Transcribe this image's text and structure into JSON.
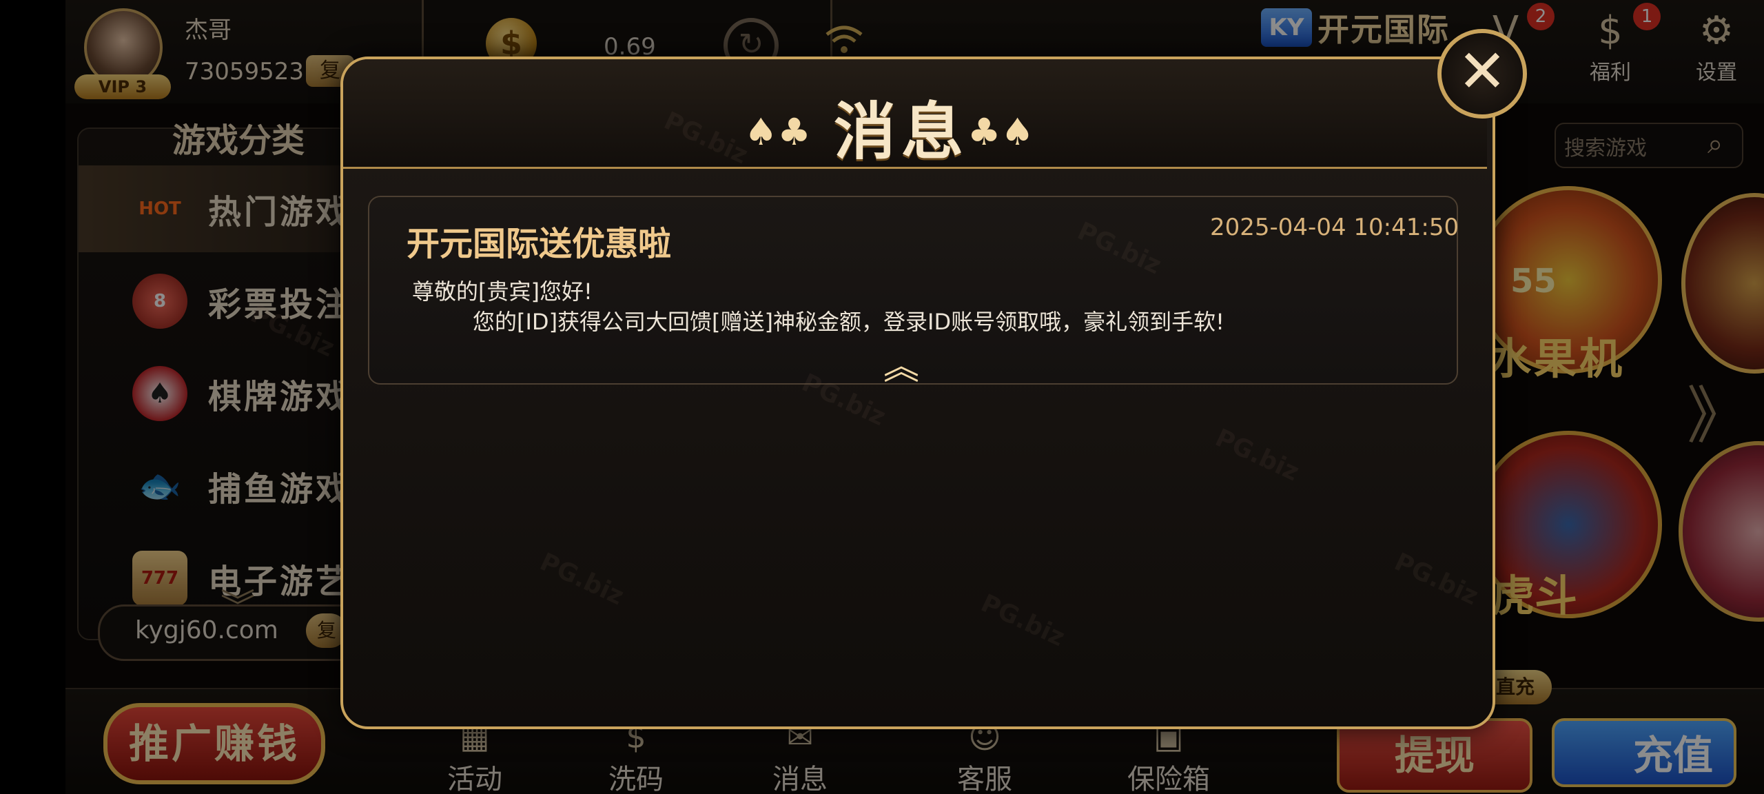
{
  "user": {
    "name": "杰哥",
    "id": "73059523",
    "vip_label": "VIP 3",
    "copy_label": "复"
  },
  "wallet": {
    "balance": "0.69",
    "coin_symbol": "$",
    "refresh_symbol": "↻",
    "wifi_symbol": "📶"
  },
  "brand": {
    "logo": "KY",
    "name": "开元国际"
  },
  "top_icons": [
    {
      "icon": "vip-icon",
      "glyph": "V",
      "label": "",
      "badge": "2"
    },
    {
      "icon": "moneybag-icon",
      "glyph": "$",
      "label": "福利",
      "badge": "1"
    },
    {
      "icon": "gear-icon",
      "glyph": "⚙",
      "label": "设置",
      "badge": ""
    }
  ],
  "sidebar": {
    "title": "游戏分类",
    "items": [
      {
        "label": "热门游戏",
        "icon": "hot-icon",
        "glyph": "HOT",
        "active": true
      },
      {
        "label": "彩票投注",
        "icon": "lottery-icon",
        "glyph": "8",
        "active": false
      },
      {
        "label": "棋牌游戏",
        "icon": "chess-icon",
        "glyph": "♠",
        "active": false
      },
      {
        "label": "捕鱼游戏",
        "icon": "fish-icon",
        "glyph": "🐟",
        "active": false
      },
      {
        "label": "电子游艺",
        "icon": "slots-icon",
        "glyph": "777",
        "active": false
      }
    ],
    "down_symbol": "︾",
    "url": "kygj60.com",
    "url_copy": "复"
  },
  "search": {
    "placeholder": "搜索游戏",
    "icon_glyph": "⌕"
  },
  "games": {
    "t1": "水果机",
    "t3": "虎斗",
    "next_symbol": "》",
    "t1_badge": "55"
  },
  "bottom": {
    "promo": "推广赚钱",
    "nav": [
      {
        "icon": "gift-icon",
        "glyph": "▦",
        "label": "活动"
      },
      {
        "icon": "wash-icon",
        "glyph": "$",
        "label": "洗码"
      },
      {
        "icon": "message-icon",
        "glyph": "✉",
        "label": "消息"
      },
      {
        "icon": "service-icon",
        "glyph": "☺",
        "label": "客服"
      },
      {
        "icon": "safe-icon",
        "glyph": "▣",
        "label": "保险箱"
      }
    ],
    "direct_label": "直充",
    "withdraw": "提现",
    "recharge": "充值"
  },
  "modal": {
    "title": "消息",
    "close_symbol": "✕",
    "suits_left": "♠♣",
    "suits_right": "♣♠",
    "message": {
      "title": "开元国际送优惠啦",
      "time": "2025-04-04 10:41:50",
      "line1": "尊敬的[贵宾]您好!",
      "line2": "您的[ID]获得公司大回馈[赠送]神秘金额，登录ID账号领取哦，豪礼领到手软!",
      "collapse_symbol": "︽"
    }
  },
  "watermark": "PG.biz"
}
